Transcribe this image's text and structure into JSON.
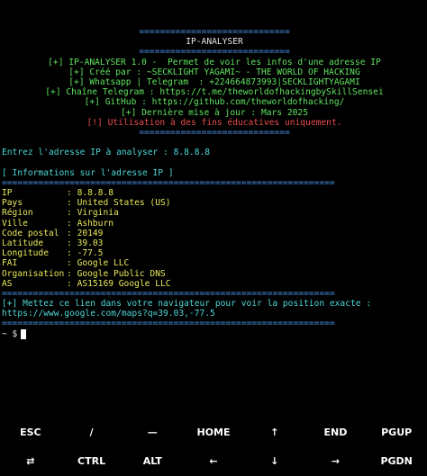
{
  "banner": {
    "border": "=============================",
    "title": "IP-ANALYSER",
    "line1": "[+] IP-ANALYSER 1.0 -  Permet de voir les infos d'une adresse IP",
    "line2": "[+] Créé par : ~SECKLIGHT YAGAMI~ - THE WORLD OF HACKING",
    "line3": "[+] Whatsapp | Telegram  : +224664873993|SECKLIGHTYAGAMI",
    "line4": "[+] Chaîne Telegram : https://t.me/theworldofhackingbySkillSensei",
    "line5": "[+] GitHub : https://github.com/theworldofhacking/",
    "line6": "[+] Dernière mise à jour : Mars 2025",
    "line7": "[!] Utilisation à des fins éducatives uniquement.",
    "border_bottom": "============================="
  },
  "prompt_input": "Entrez l'adresse IP à analyser : 8.8.8.8",
  "info_header": "[ Informations sur l'adresse IP ]",
  "separator": "================================================================",
  "info": [
    {
      "key": "IP",
      "value": "8.8.8.8"
    },
    {
      "key": "Pays",
      "value": "United States (US)"
    },
    {
      "key": "Région",
      "value": "Virginia"
    },
    {
      "key": "Ville",
      "value": "Ashburn"
    },
    {
      "key": "Code postal",
      "value": "20149"
    },
    {
      "key": "Latitude",
      "value": "39.03"
    },
    {
      "key": "Longitude",
      "value": "-77.5"
    },
    {
      "key": "FAI",
      "value": "Google LLC"
    },
    {
      "key": "Organisation",
      "value": "Google Public DNS"
    },
    {
      "key": "AS",
      "value": "AS15169 Google LLC"
    }
  ],
  "maps_text": "[+] Mettez ce lien dans votre navigateur pour voir la position exacte :",
  "maps_link": "https://www.google.com/maps?q=39.03,-77.5",
  "shell_prompt": "~ $",
  "keyboard": {
    "row1": [
      "ESC",
      "/",
      "—",
      "HOME",
      "↑",
      "END",
      "PGUP"
    ],
    "row2": [
      "⇄",
      "CTRL",
      "ALT",
      "←",
      "↓",
      "→",
      "PGDN"
    ]
  },
  "colors": {
    "background": "#000000",
    "yellow": "#e8e85a",
    "blue": "#4a90e2",
    "green": "#5fe35f",
    "red": "#e84c4c",
    "cyan": "#4fd6d6"
  }
}
